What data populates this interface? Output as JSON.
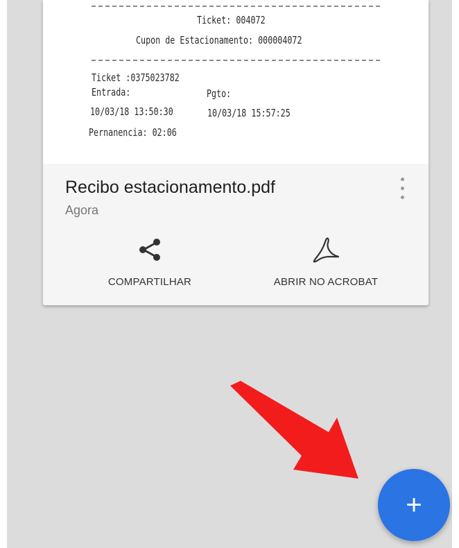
{
  "receipt": {
    "lines": [
      "Ticket: 004072",
      "Cupon de Estacionamento: 000004072",
      "Ticket :0375023782",
      "Entrada:",
      "Pgto:",
      "10/03/18 13:50:30",
      "10/03/18 15:57:25",
      "Pernanencia: 02:06"
    ]
  },
  "file": {
    "name": "Recibo estacionamento.pdf",
    "time": "Agora"
  },
  "actions": {
    "share_label": "COMPARTILHAR",
    "open_label": "ABRIR NO ACROBAT"
  },
  "fab": {
    "symbol": "+"
  },
  "colors": {
    "background": "#dcdcdd",
    "card": "#f5f5f5",
    "fab": "#2a74e3",
    "annotation_arrow": "#f21c1c"
  },
  "icons": [
    "share-icon",
    "acrobat-icon",
    "more-vert-icon",
    "plus-icon",
    "red-arrow"
  ]
}
